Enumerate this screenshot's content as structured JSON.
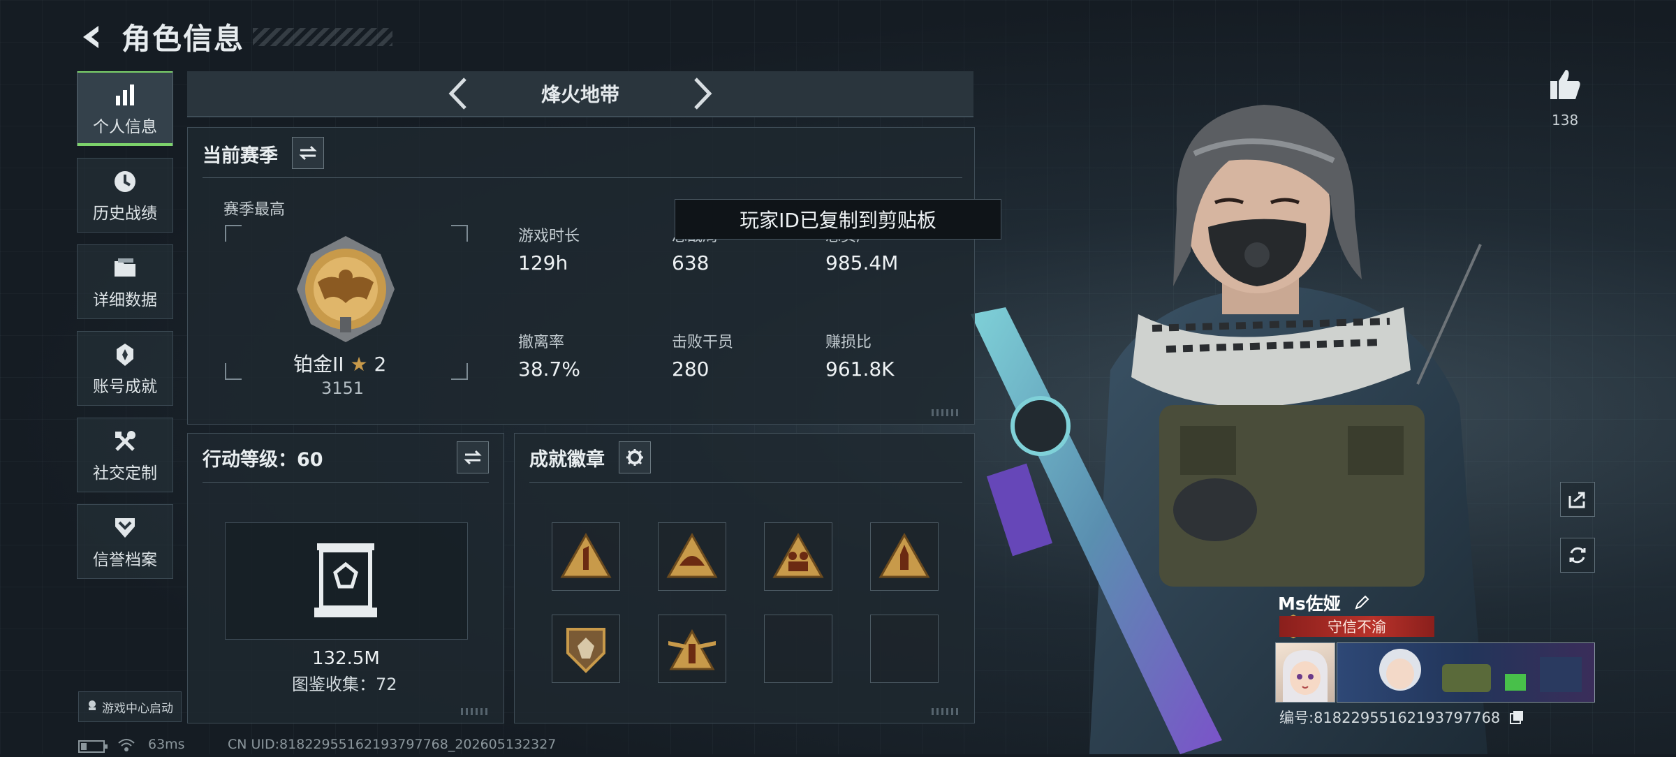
{
  "header": {
    "title": "角色信息"
  },
  "sidebar": {
    "items": [
      {
        "label": "个人信息",
        "icon": "bar-chart-icon",
        "active": true
      },
      {
        "label": "历史战绩",
        "icon": "clock-history-icon",
        "active": false
      },
      {
        "label": "详细数据",
        "icon": "folder-icon",
        "active": false
      },
      {
        "label": "账号成就",
        "icon": "medal-icon",
        "active": false
      },
      {
        "label": "社交定制",
        "icon": "tools-icon",
        "active": false
      },
      {
        "label": "信誉档案",
        "icon": "shield-chevron-icon",
        "active": false
      }
    ],
    "game_center": "游戏中心启动"
  },
  "mode": {
    "title": "烽火地带"
  },
  "season": {
    "title": "当前赛季",
    "best_label": "赛季最高",
    "rank_name": "铂金II",
    "rank_stars": "2",
    "rank_score": "3151",
    "stats": [
      {
        "label": "游戏时长",
        "value": "129h"
      },
      {
        "label": "总战局",
        "value": "638"
      },
      {
        "label": "总资产",
        "value": "985.4M"
      },
      {
        "label": "撤离率",
        "value": "38.7%"
      },
      {
        "label": "击败干员",
        "value": "280"
      },
      {
        "label": "赚损比",
        "value": "961.8K"
      }
    ]
  },
  "toast": {
    "text": "玩家ID已复制到剪贴板"
  },
  "level": {
    "title": "行动等级：60",
    "value": "132.5M",
    "collection": "图鉴收集：72"
  },
  "achievements": {
    "title": "成就徽章",
    "badges": [
      {
        "icon": "number-one-triangle-badge",
        "filled": true
      },
      {
        "icon": "helmet-triangle-badge",
        "filled": true
      },
      {
        "icon": "soldiers-triangle-badge",
        "filled": true
      },
      {
        "icon": "rocket-triangle-badge",
        "filled": true
      },
      {
        "icon": "gem-shield-badge",
        "filled": true
      },
      {
        "icon": "winged-tower-badge",
        "filled": true
      },
      {
        "icon": "empty-slot",
        "filled": false
      },
      {
        "icon": "empty-slot",
        "filled": false
      }
    ]
  },
  "likes": {
    "count": "138"
  },
  "player": {
    "name": "Ms佐娅",
    "title_badge": "守信不渝",
    "id_text": "编号:8182295516219379776​8"
  },
  "status": {
    "ping": "63ms",
    "uid": "CN UID:8182295516219379776​8_202605132327"
  },
  "colors": {
    "accent_green": "#7dd36b",
    "gold": "#c89a4a",
    "title_red": "#b8322a"
  }
}
